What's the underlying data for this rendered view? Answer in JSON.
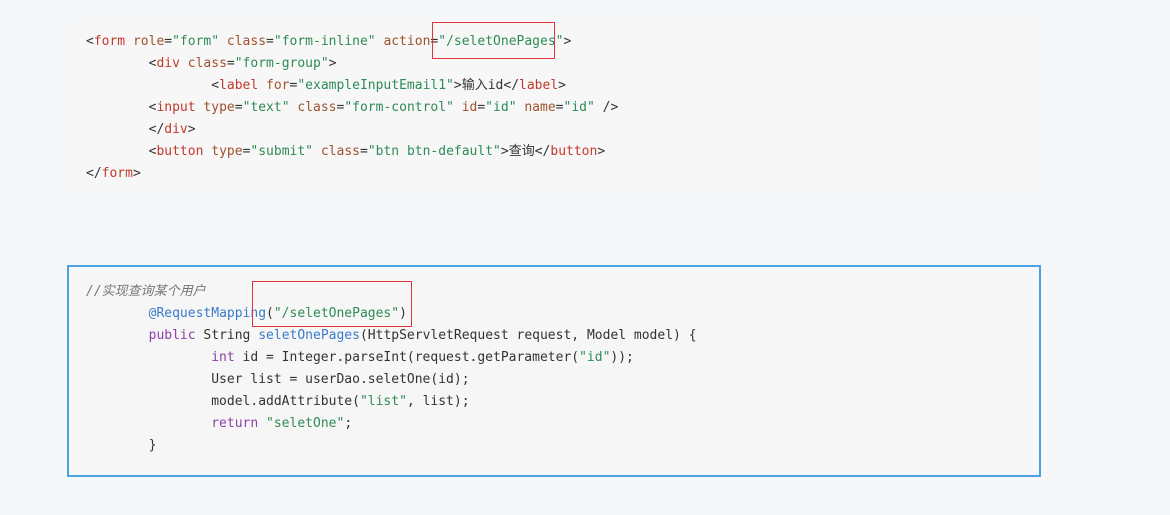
{
  "html_snippet": {
    "line1": {
      "open": "<",
      "tag": "form",
      "sp1": " ",
      "a1": "role",
      "eq1": "=",
      "v1": "\"form\"",
      "sp2": " ",
      "a2": "class",
      "eq2": "=",
      "v2": "\"form-inline\"",
      "sp3": " ",
      "a3": "action",
      "eq3": "=",
      "v3": "\"/seletOnePages\"",
      "close": ">"
    },
    "line2": {
      "indent": "        ",
      "open": "<",
      "tag": "div",
      "sp1": " ",
      "a1": "class",
      "eq1": "=",
      "v1": "\"form-group\"",
      "close": ">"
    },
    "line3": {
      "indent": "                ",
      "open": "<",
      "tag": "label",
      "sp1": " ",
      "a1": "for",
      "eq1": "=",
      "v1": "\"exampleInputEmail1\"",
      "close": ">",
      "text": "输入id",
      "endopen": "</",
      "endtag": "label",
      "endclose": ">"
    },
    "line4": {
      "indent": "        ",
      "open": "<",
      "tag": "input",
      "sp1": " ",
      "a1": "type",
      "eq1": "=",
      "v1": "\"text\"",
      "sp2": " ",
      "a2": "class",
      "eq2": "=",
      "v2": "\"form-control\"",
      "sp3": " ",
      "a3": "id",
      "eq3": "=",
      "v3": "\"id\"",
      "sp4": " ",
      "a4": "name",
      "eq4": "=",
      "v4": "\"id\"",
      "close": " />"
    },
    "line5": {
      "indent": "        ",
      "open": "</",
      "tag": "div",
      "close": ">"
    },
    "line6": {
      "indent": "        ",
      "open": "<",
      "tag": "button",
      "sp1": " ",
      "a1": "type",
      "eq1": "=",
      "v1": "\"submit\"",
      "sp2": " ",
      "a2": "class",
      "eq2": "=",
      "v2": "\"btn btn-default\"",
      "close": ">",
      "text": "查询",
      "endopen": "</",
      "endtag": "button",
      "endclose": ">"
    },
    "line7": {
      "open": "</",
      "tag": "form",
      "close": ">"
    }
  },
  "java_snippet": {
    "comment": "//实现查询某个用户",
    "l2": {
      "indent": "        ",
      "anno": "@RequestMapping",
      "p1": "(",
      "str": "\"/seletOnePages\"",
      "p2": ")"
    },
    "l3": {
      "indent": "        ",
      "kw": "public",
      "rest1": " String ",
      "fn": "seletOnePages",
      "rest2": "(HttpServletRequest request, Model model) {"
    },
    "l4": {
      "indent": "                ",
      "kw": "int",
      "rest1": " id = Integer.parseInt(request.getParameter(",
      "str": "\"id\"",
      "rest2": "));"
    },
    "l5": {
      "indent": "                ",
      "text": "User list = userDao.seletOne(id);"
    },
    "l6": {
      "indent": "                ",
      "rest1": "model.addAttribute(",
      "str": "\"list\"",
      "rest2": ", list);"
    },
    "l7": {
      "indent": "                ",
      "kw": "return",
      "sp": " ",
      "str": "\"seletOne\"",
      "end": ";"
    },
    "l8": {
      "indent": "        ",
      "text": "}"
    }
  },
  "colors": {
    "frame": "#4aa3df",
    "highlight": "#e0363b",
    "string": "#2e8b57",
    "tag": "#c0392b",
    "keyword": "#8b3fa8",
    "annotation": "#3a7bc8"
  }
}
